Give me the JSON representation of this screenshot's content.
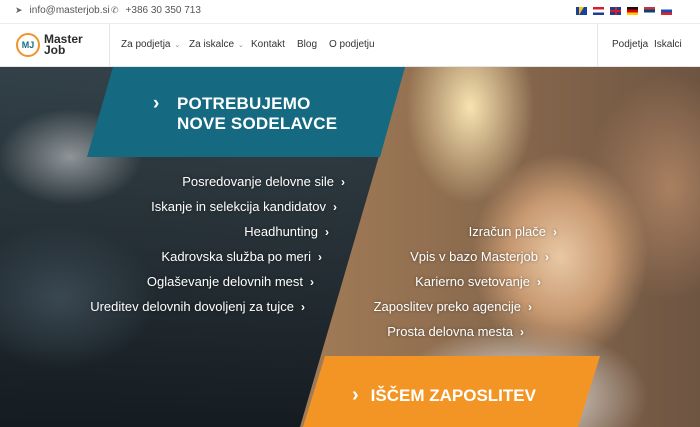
{
  "topbar": {
    "email": "info@masterjob.si",
    "phone": "+386 30 350 713",
    "email_icon": "paper-plane-icon",
    "phone_icon": "phone-icon",
    "languages": [
      "bs",
      "hr",
      "en",
      "de",
      "sr",
      "sl"
    ]
  },
  "nav": {
    "logo_mark": "MJ",
    "logo_line1": "Master",
    "logo_line2": "Job",
    "items": [
      {
        "label": "Za podjetja",
        "has_dropdown": true
      },
      {
        "label": "Za iskalce",
        "has_dropdown": true
      },
      {
        "label": "Kontakt",
        "has_dropdown": false
      },
      {
        "label": "Blog",
        "has_dropdown": false
      },
      {
        "label": "O podjetju",
        "has_dropdown": false
      }
    ],
    "right_items": [
      "Podjetja",
      "Iskalci"
    ]
  },
  "hero": {
    "banner_line1": "POTREBUJEMO",
    "banner_line2": "NOVE SODELAVCE",
    "cta": "IŠČEM ZAPOSLITEV",
    "employer_links": [
      "Posredovanje delovne sile",
      "Iskanje in selekcija kandidatov",
      "Headhunting",
      "Kadrovska služba po meri",
      "Oglaševanje delovnih mest",
      "Ureditev delovnih dovoljenj za tujce"
    ],
    "candidate_links": [
      "Izračun plače",
      "Vpis v bazo Masterjob",
      "Karierno svetovanje",
      "Zaposlitev preko agencije",
      "Prosta delovna mesta"
    ],
    "chevron": "›",
    "colors": {
      "teal": "#156a82",
      "orange": "#f39524"
    }
  }
}
